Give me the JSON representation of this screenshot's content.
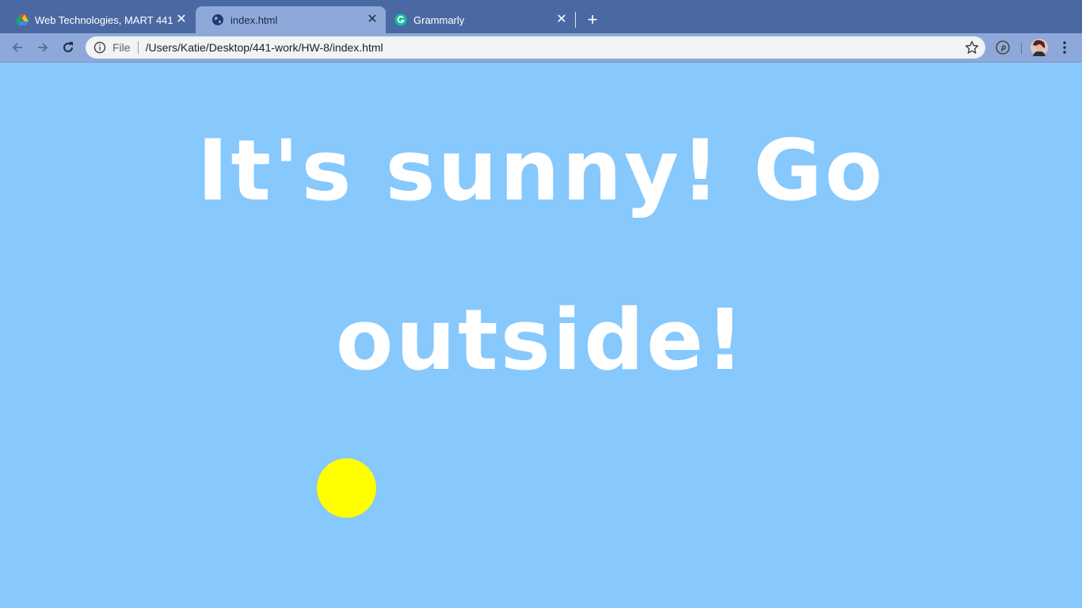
{
  "browser": {
    "tabs": [
      {
        "title": "Web Technologies, MART 441 |",
        "icon": "google-drive-icon",
        "active": false
      },
      {
        "title": "index.html",
        "icon": "globe-icon",
        "active": true
      },
      {
        "title": "Grammarly",
        "icon": "grammarly-icon",
        "active": false
      }
    ],
    "close_glyph": "✕",
    "new_tab_glyph": "+",
    "address": {
      "scheme_label": "File",
      "url": "/Users/Katie/Desktop/441-work/HW-8/index.html"
    }
  },
  "page": {
    "headline": "It's sunny! Go outside!",
    "background_color": "#87c8fd",
    "sun_color": "#ffff00",
    "text_color": "#ffffff"
  }
}
